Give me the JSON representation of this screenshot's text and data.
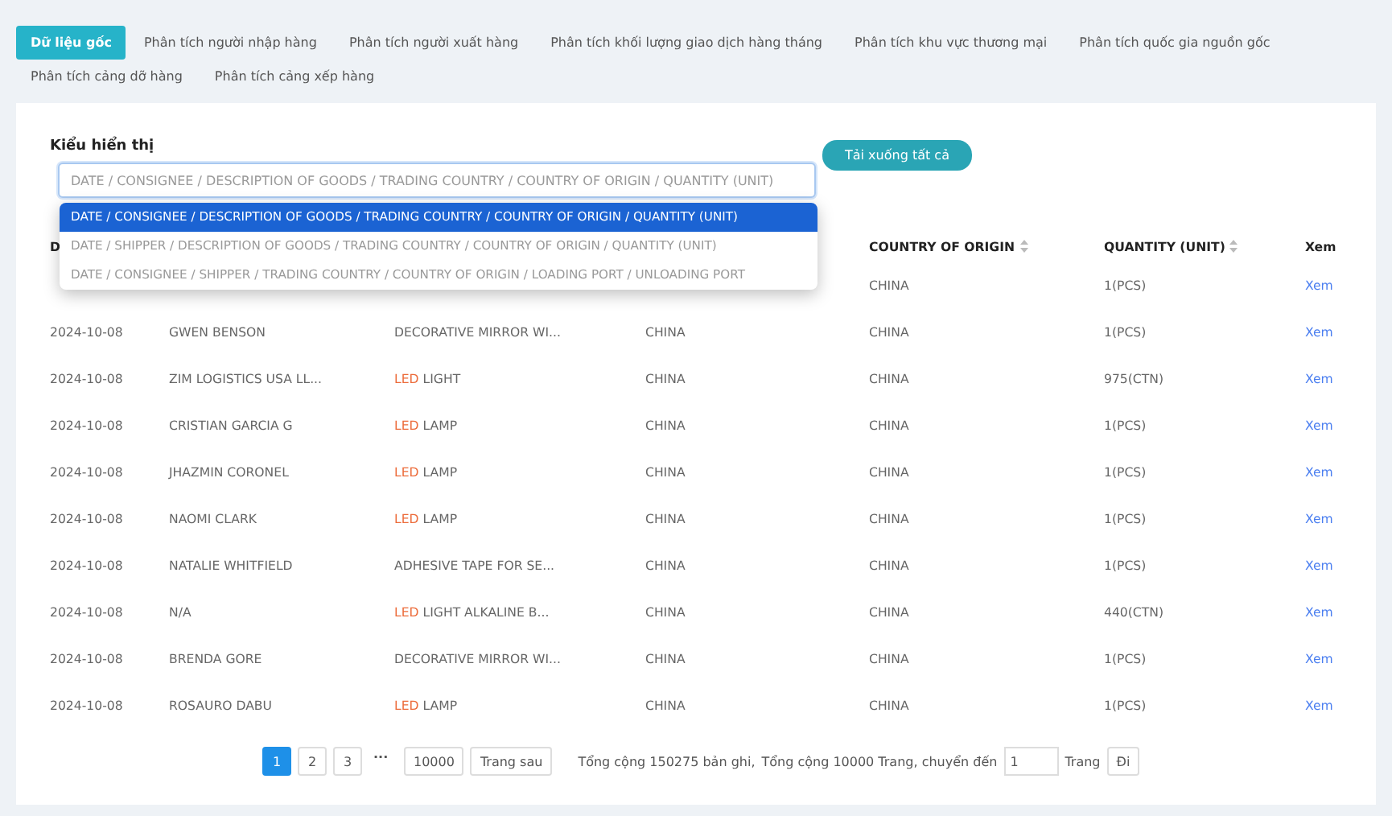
{
  "tabs": [
    {
      "label": "Dữ liệu gốc",
      "selected": true
    },
    {
      "label": "Phân tích người nhập hàng",
      "selected": false
    },
    {
      "label": "Phân tích người xuất hàng",
      "selected": false
    },
    {
      "label": "Phân tích khối lượng giao dịch hàng tháng",
      "selected": false
    },
    {
      "label": "Phân tích khu vực thương mại",
      "selected": false
    },
    {
      "label": "Phân tích quốc gia nguồn gốc",
      "selected": false
    },
    {
      "label": "Phân tích cảng dỡ hàng",
      "selected": false
    },
    {
      "label": "Phân tích cảng xếp hàng",
      "selected": false
    }
  ],
  "display_mode": {
    "label": "Kiểu hiển thị",
    "placeholder": "DATE / CONSIGNEE / DESCRIPTION OF GOODS / TRADING COUNTRY / COUNTRY OF ORIGIN / QUANTITY (UNIT)",
    "expanded": true,
    "options": [
      {
        "label": "DATE / CONSIGNEE / DESCRIPTION OF GOODS / TRADING COUNTRY / COUNTRY OF ORIGIN / QUANTITY (UNIT)",
        "selected": true
      },
      {
        "label": "DATE / SHIPPER / DESCRIPTION OF GOODS / TRADING COUNTRY / COUNTRY OF ORIGIN / QUANTITY (UNIT)",
        "selected": false
      },
      {
        "label": "DATE / CONSIGNEE / SHIPPER / TRADING COUNTRY / COUNTRY OF ORIGIN / LOADING PORT / UNLOADING PORT",
        "selected": false
      }
    ]
  },
  "download_button": "Tải xuống tất cả",
  "table": {
    "columns": [
      {
        "label": "D",
        "sortable": false
      },
      {},
      {},
      {},
      {
        "label": "COUNTRY OF ORIGIN",
        "sortable": true
      },
      {
        "label": "QUANTITY (UNIT)",
        "sortable": true
      },
      {
        "label": "Xem",
        "sortable": false
      }
    ],
    "rows": [
      {
        "country_of_origin": "CHINA",
        "quantity": "1(PCS)",
        "view": "Xem"
      },
      {
        "date": "2024-10-08",
        "consignee": "GWEN BENSON",
        "goods": {
          "text": "DECORATIVE MIRROR WI..."
        },
        "trading_country": "CHINA",
        "country_of_origin": "CHINA",
        "quantity": "1(PCS)",
        "view": "Xem"
      },
      {
        "date": "2024-10-08",
        "consignee": "ZIM LOGISTICS USA LL...",
        "goods": {
          "highlight": "LED",
          "text": "LIGHT"
        },
        "trading_country": "CHINA",
        "country_of_origin": "CHINA",
        "quantity": "975(CTN)",
        "view": "Xem"
      },
      {
        "date": "2024-10-08",
        "consignee": "CRISTIAN GARCIA G",
        "goods": {
          "highlight": "LED",
          "text": "LAMP"
        },
        "trading_country": "CHINA",
        "country_of_origin": "CHINA",
        "quantity": "1(PCS)",
        "view": "Xem"
      },
      {
        "date": "2024-10-08",
        "consignee": "JHAZMIN CORONEL",
        "goods": {
          "highlight": "LED",
          "text": "LAMP"
        },
        "trading_country": "CHINA",
        "country_of_origin": "CHINA",
        "quantity": "1(PCS)",
        "view": "Xem"
      },
      {
        "date": "2024-10-08",
        "consignee": "NAOMI CLARK",
        "goods": {
          "highlight": "LED",
          "text": "LAMP"
        },
        "trading_country": "CHINA",
        "country_of_origin": "CHINA",
        "quantity": "1(PCS)",
        "view": "Xem"
      },
      {
        "date": "2024-10-08",
        "consignee": "NATALIE WHITFIELD",
        "goods": {
          "text": "ADHESIVE TAPE FOR SE..."
        },
        "trading_country": "CHINA",
        "country_of_origin": "CHINA",
        "quantity": "1(PCS)",
        "view": "Xem"
      },
      {
        "date": "2024-10-08",
        "consignee": "N/A",
        "goods": {
          "highlight": "LED",
          "text": "LIGHT ALKALINE B..."
        },
        "trading_country": "CHINA",
        "country_of_origin": "CHINA",
        "quantity": "440(CTN)",
        "view": "Xem"
      },
      {
        "date": "2024-10-08",
        "consignee": "BRENDA GORE",
        "goods": {
          "text": "DECORATIVE MIRROR WI..."
        },
        "trading_country": "CHINA",
        "country_of_origin": "CHINA",
        "quantity": "1(PCS)",
        "view": "Xem"
      },
      {
        "date": "2024-10-08",
        "consignee": "ROSAURO DABU",
        "goods": {
          "highlight": "LED",
          "text": "LAMP"
        },
        "trading_country": "CHINA",
        "country_of_origin": "CHINA",
        "quantity": "1(PCS)",
        "view": "Xem"
      }
    ]
  },
  "pagination": {
    "pages": [
      {
        "label": "1",
        "selected": true
      },
      {
        "label": "2",
        "selected": false
      },
      {
        "label": "3",
        "selected": false
      },
      {
        "label": "...",
        "kind": "ellipsis"
      },
      {
        "label": "10000",
        "selected": false
      }
    ],
    "next_button": "Trang sau",
    "total_records": "Tổng cộng 150275 bản ghi,",
    "total_pages": "Tổng cộng 10000 Trang, chuyển đến",
    "goto_value": "1",
    "page_word": "Trang",
    "go_button": "Đi"
  }
}
